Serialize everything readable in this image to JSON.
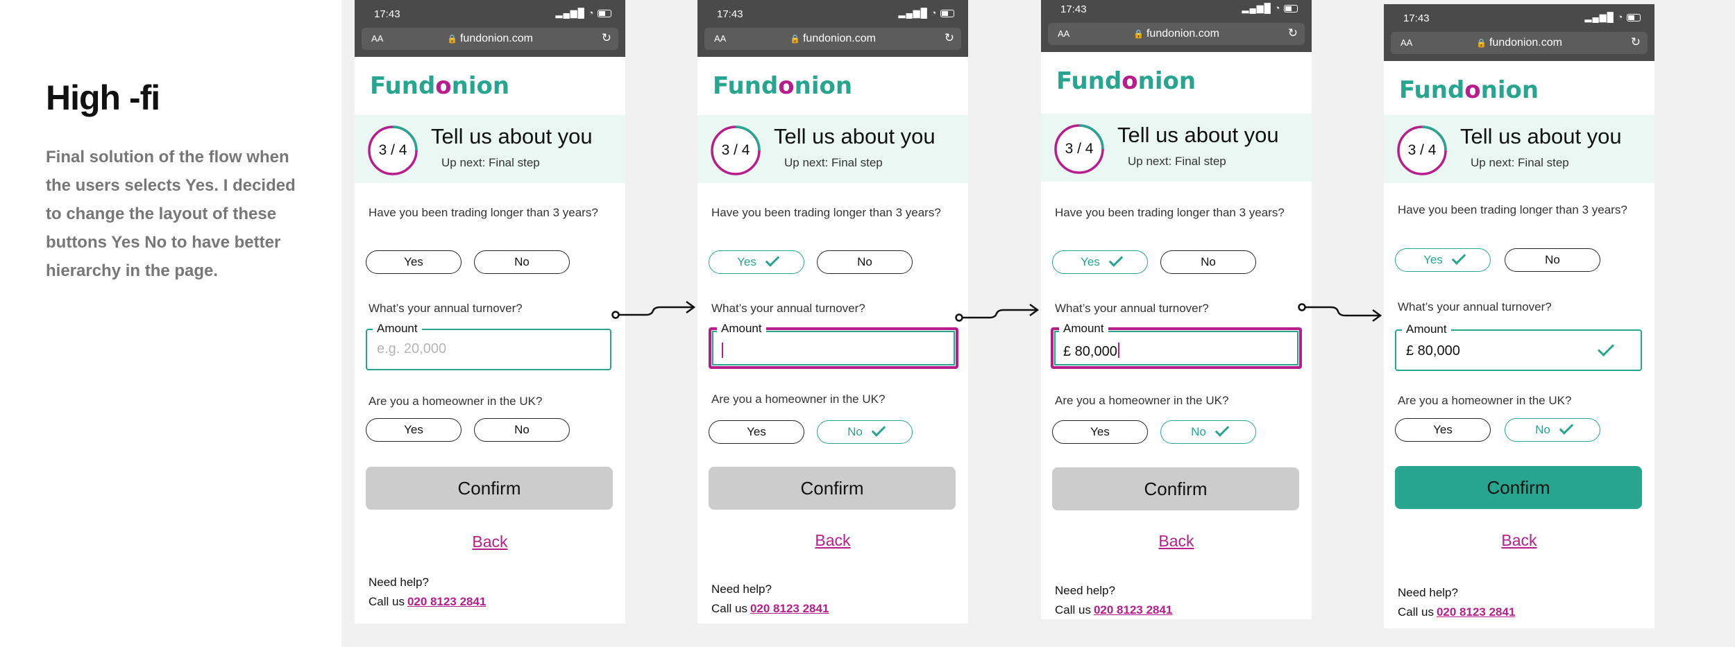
{
  "left": {
    "heading": "High -fi",
    "description": "Final solution of the flow when the users selects Yes. I decided to change the layout of these buttons Yes No to have better hierarchy in the page."
  },
  "colors": {
    "brand_green": "#27a58f",
    "brand_magenta": "#b81e8b",
    "status_bar": "#4a4a4a",
    "canvas": "#f1f1f1"
  },
  "icons": [
    "lock-icon",
    "reload-icon",
    "signal-icon",
    "wifi-icon",
    "battery-icon",
    "check-icon",
    "arrow-icon"
  ],
  "common": {
    "time": "17:43",
    "signal": "▂▄▆█",
    "wifi": "◔",
    "aa": "AA",
    "url": "fundonion.com",
    "lock": "🔒",
    "reload": "↻",
    "logo_pre": "Fund",
    "logo_o": "o",
    "logo_post": "nion",
    "step_count": "3 / 4",
    "step_title": "Tell us about you",
    "step_next": "Up next: Final step",
    "q1": "Have you been trading longer than 3 years?",
    "q2": "What’s your annual turnover?",
    "q3": "Are you a homeowner in the UK?",
    "yes": "Yes",
    "no": "No",
    "amount_label": "Amount",
    "amount_placeholder": "e.g. 20,000",
    "confirm": "Confirm",
    "back": "Back",
    "need_help": "Need help?",
    "call_us": "Call us",
    "phone": "020 8123 2841"
  },
  "screens": [
    {
      "amount": "",
      "q1_answer": "none",
      "q3_answer": "none",
      "confirm_enabled": false
    },
    {
      "amount": "",
      "q1_answer": "Yes",
      "q3_answer": "No",
      "confirm_enabled": false
    },
    {
      "amount": "£ 80,000",
      "q1_answer": "Yes",
      "q3_answer": "No",
      "confirm_enabled": false
    },
    {
      "amount": "£ 80,000",
      "q1_answer": "Yes",
      "q3_answer": "No",
      "confirm_enabled": true
    }
  ]
}
